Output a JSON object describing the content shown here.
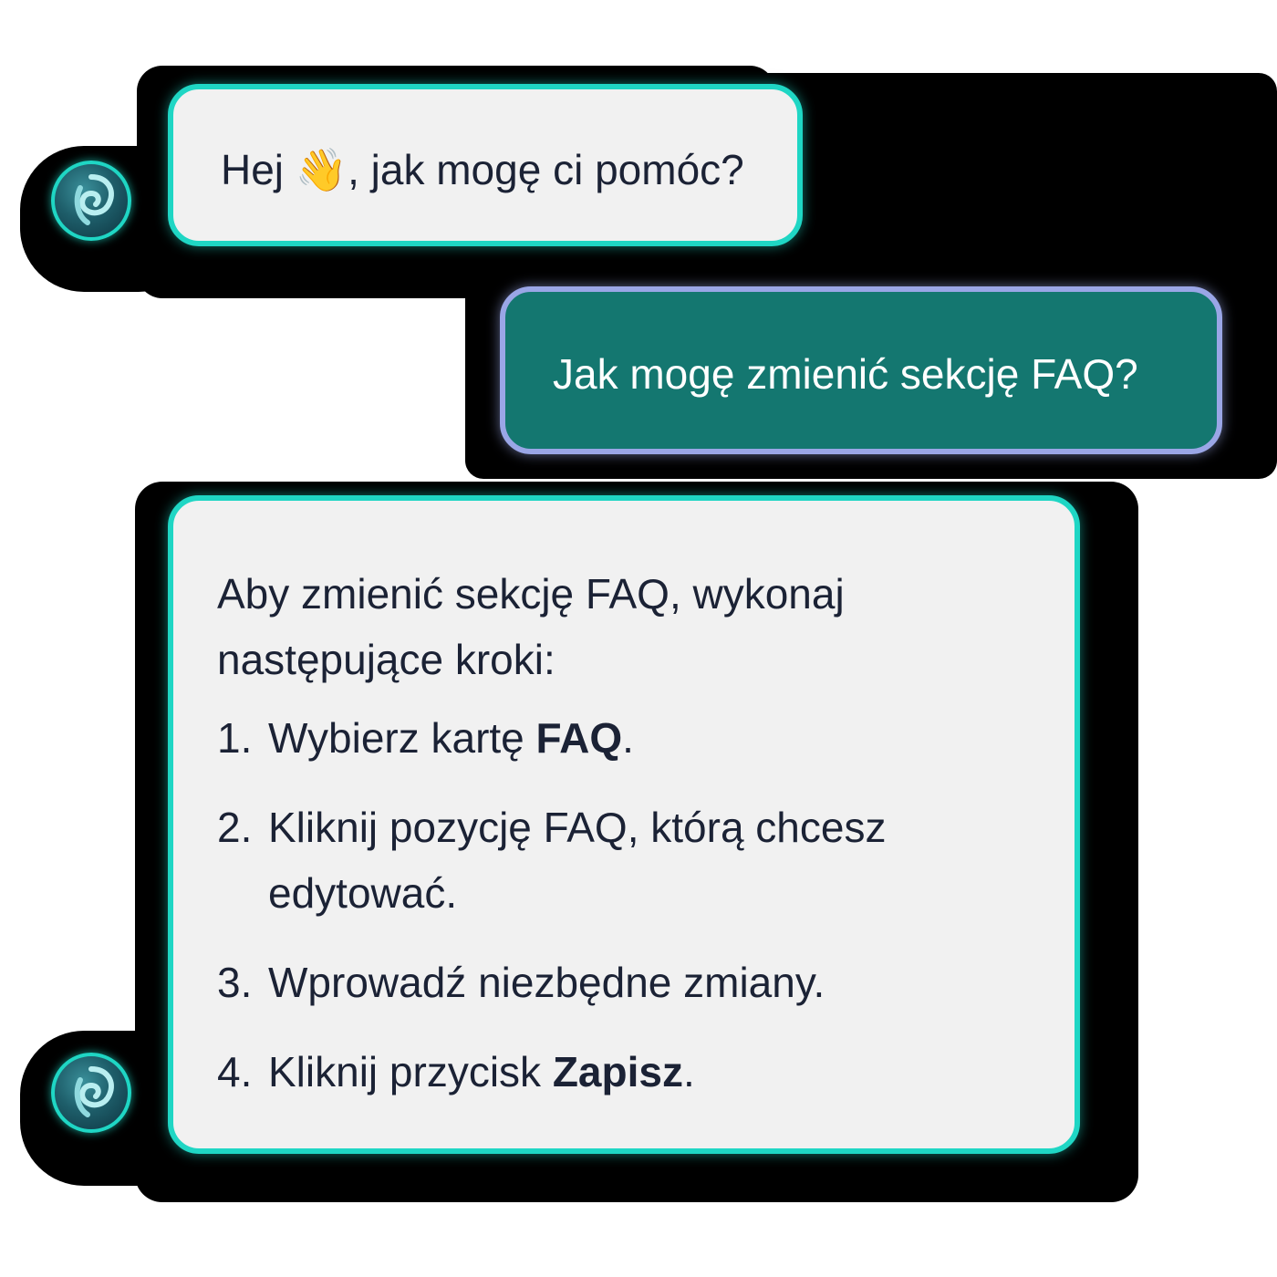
{
  "colors": {
    "bot_bubble_bg": "#f1f1f1",
    "bot_bubble_border": "#1fd6c4",
    "user_bubble_bg": "#147770",
    "user_bubble_border": "#9aa6e6",
    "text_dark": "#1b2235"
  },
  "messages": {
    "greeting": {
      "before_emoji": "Hej ",
      "emoji": "👋",
      "after_emoji": ", jak mogę ci pomóc?",
      "avatar_icon": "assistant-logo-icon"
    },
    "user_question": {
      "text": "Jak mogę zmienić sekcję FAQ?"
    },
    "answer": {
      "intro": "Aby zmienić sekcję FAQ, wykonaj następujące kroki:",
      "avatar_icon": "assistant-logo-icon",
      "steps": [
        {
          "num": "1.",
          "before": "Wybierz kartę ",
          "bold": "FAQ",
          "after": "."
        },
        {
          "num": "2.",
          "before": "Kliknij pozycję FAQ, którą chcesz edytować.",
          "bold": "",
          "after": ""
        },
        {
          "num": "3.",
          "before": "Wprowadź niezbędne zmiany.",
          "bold": "",
          "after": ""
        },
        {
          "num": "4.",
          "before": "Kliknij przycisk ",
          "bold": "Zapisz",
          "after": "."
        }
      ]
    }
  }
}
